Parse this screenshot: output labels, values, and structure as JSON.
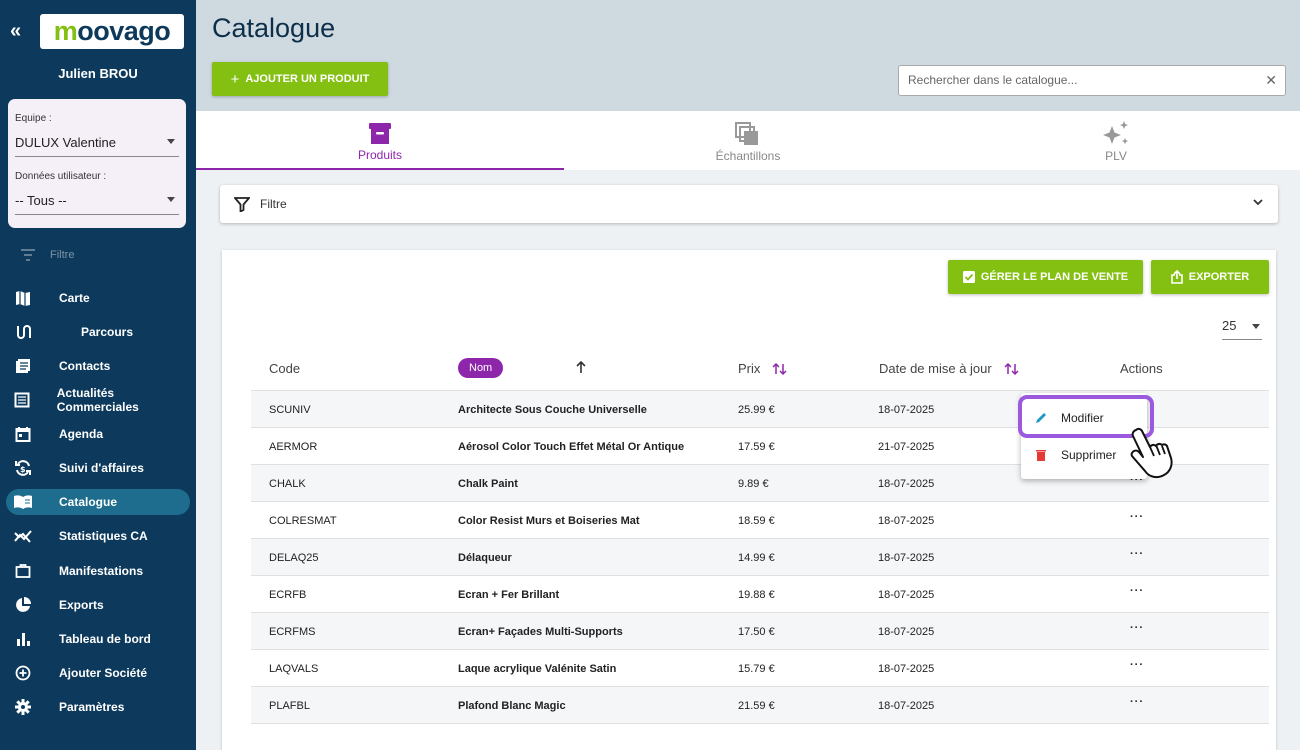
{
  "sidebar": {
    "collapse_glyph": "«",
    "logo": {
      "first": "m",
      "rest": "oovago"
    },
    "user_name": "Julien BROU",
    "equipe_label": "Equipe :",
    "equipe_value": "DULUX Valentine",
    "donnees_label": "Données utilisateur :",
    "donnees_value": "-- Tous --",
    "filter_label": "Filtre",
    "nav": [
      {
        "label": "Carte",
        "icon": "map-icon"
      },
      {
        "label": "Parcours",
        "icon": "route-icon"
      },
      {
        "label": "Contacts",
        "icon": "contacts-icon"
      },
      {
        "label": "Actualités Commerciales",
        "icon": "news-icon"
      },
      {
        "label": "Agenda",
        "icon": "calendar-icon"
      },
      {
        "label": "Suivi d'affaires",
        "icon": "sync-icon"
      },
      {
        "label": "Catalogue",
        "icon": "book-icon",
        "active": true
      },
      {
        "label": "Statistiques CA",
        "icon": "stats-icon"
      },
      {
        "label": "Manifestations",
        "icon": "briefcase-icon"
      },
      {
        "label": "Exports",
        "icon": "pie-icon"
      },
      {
        "label": "Tableau de bord",
        "icon": "bars-icon"
      },
      {
        "label": "Ajouter Société",
        "icon": "add-circle-icon"
      },
      {
        "label": "Paramètres",
        "icon": "gear-icon"
      }
    ]
  },
  "header": {
    "title": "Catalogue",
    "add_button": "AJOUTER UN PRODUIT",
    "search_placeholder": "Rechercher dans le catalogue..."
  },
  "tabs": [
    {
      "label": "Produits",
      "icon": "archive-box-icon",
      "active": true
    },
    {
      "label": "Échantillons",
      "icon": "samples-icon"
    },
    {
      "label": "PLV",
      "icon": "sparkle-icon"
    }
  ],
  "filter_bar": {
    "label": "Filtre"
  },
  "toolbar": {
    "plan_button": "GÉRER LE PLAN DE VENTE",
    "export_button": "EXPORTER",
    "page_size": "25"
  },
  "table": {
    "headers": {
      "code": "Code",
      "nom": "Nom",
      "prix": "Prix",
      "date": "Date de mise à jour",
      "actions": "Actions"
    },
    "rows": [
      {
        "code": "SCUNIV",
        "nom": "Architecte Sous Couche Universelle",
        "prix": "25.99 €",
        "date": "18-07-2025",
        "actions": ""
      },
      {
        "code": "AERMOR",
        "nom": "Aérosol Color Touch Effet Métal Or Antique",
        "prix": "17.59 €",
        "date": "21-07-2025",
        "actions": ""
      },
      {
        "code": "CHALK",
        "nom": "Chalk Paint",
        "prix": "9.89 €",
        "date": "18-07-2025",
        "actions": "···"
      },
      {
        "code": "COLRESMAT",
        "nom": "Color Resist Murs et Boiseries Mat",
        "prix": "18.59 €",
        "date": "18-07-2025",
        "actions": "···"
      },
      {
        "code": "DELAQ25",
        "nom": "Délaqueur",
        "prix": "14.99 €",
        "date": "18-07-2025",
        "actions": "···"
      },
      {
        "code": "ECRFB",
        "nom": "Ecran + Fer Brillant",
        "prix": "19.88 €",
        "date": "18-07-2025",
        "actions": "···"
      },
      {
        "code": "ECRFMS",
        "nom": "Ecran+ Façades Multi-Supports",
        "prix": "17.50 €",
        "date": "18-07-2025",
        "actions": "···"
      },
      {
        "code": "LAQVALS",
        "nom": "Laque acrylique Valénite Satin",
        "prix": "15.79 €",
        "date": "18-07-2025",
        "actions": "···"
      },
      {
        "code": "PLAFBL",
        "nom": "Plafond Blanc Magic",
        "prix": "21.59 €",
        "date": "18-07-2025",
        "actions": "···"
      }
    ]
  },
  "context_menu": {
    "edit": "Modifier",
    "delete": "Supprimer"
  },
  "colors": {
    "sidebar": "#0d3a5c",
    "accent_green": "#84c011",
    "accent_purple": "#8d26aa",
    "highlight": "#9b59e0"
  }
}
